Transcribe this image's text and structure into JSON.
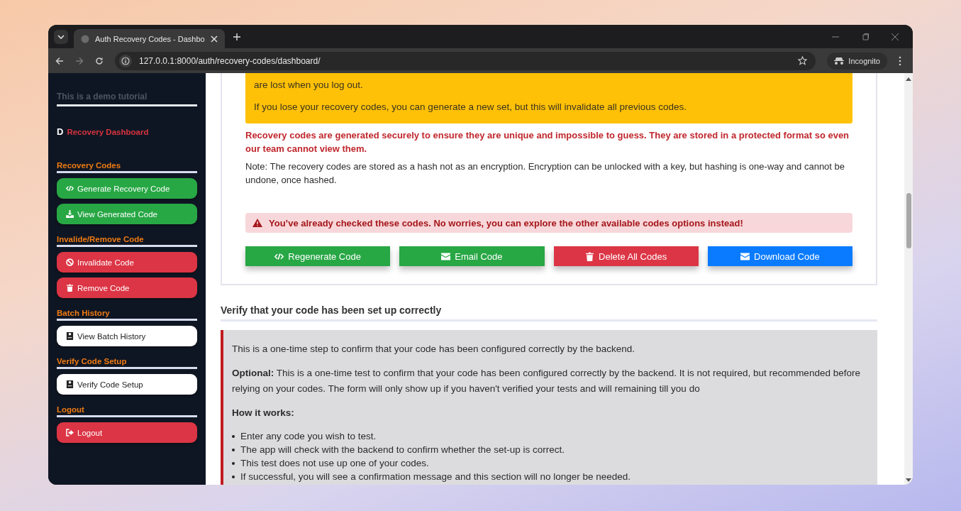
{
  "browser": {
    "tab_title": "Auth Recovery Codes - Dashbo",
    "url": "127.0.0.1:8000/auth/recovery-codes/dashboard/",
    "profile_label": "Incognito"
  },
  "sidebar": {
    "tagline": "This is a demo tutorial",
    "brand_letter": "D",
    "brand": "Recovery Dashboard",
    "sections": [
      {
        "title": "Recovery Codes",
        "buttons": [
          {
            "label": "Generate Recovery Code",
            "kind": "success"
          },
          {
            "label": "View Generated Code",
            "kind": "success"
          }
        ]
      },
      {
        "title": "Invalide/Remove Code",
        "buttons": [
          {
            "label": "Invalidate Code",
            "kind": "danger"
          },
          {
            "label": "Remove Code",
            "kind": "danger"
          }
        ]
      },
      {
        "title": "Batch History",
        "buttons": [
          {
            "label": "View Batch History",
            "kind": "light"
          }
        ]
      },
      {
        "title": "Verify Code Setup",
        "buttons": [
          {
            "label": "Verify Code Setup",
            "kind": "light"
          }
        ]
      },
      {
        "title": "Logout",
        "buttons": [
          {
            "label": "Logout",
            "kind": "danger"
          }
        ]
      }
    ]
  },
  "main": {
    "notice_lines": [
      "are lost when you log out.",
      "If you lose your recovery codes, you can generate a new set, but this will invalidate all previous codes."
    ],
    "secure_text": "Recovery codes are generated securely to ensure they are unique and impossible to guess. They are stored in a protected format so even our team cannot view them.",
    "note_text": "Note: The recovery codes are stored as a hash not as an encryption. Encryption can be unlocked with a key, but hashing is one-way and cannot be undone, once hashed.",
    "alert": "You’ve already checked these codes. No worries, you can explore the other available codes options instead!",
    "actions": [
      {
        "label": "Regenerate Code",
        "kind": "success"
      },
      {
        "label": "Email Code",
        "kind": "success"
      },
      {
        "label": "Delete All Codes",
        "kind": "danger"
      },
      {
        "label": "Download Code",
        "kind": "primary"
      }
    ],
    "verify": {
      "heading": "Verify that your code has been set up correctly",
      "intro": "This is a one-time step to confirm that your code has been configured correctly by the backend.",
      "optional": "**Optional:** This is a one-time test to confirm that your code has been configured correctly by the backend. It is not required, but recommended before relying on your codes. The form will only show up if you haven't verified your tests and will remaining till you do",
      "how_title": "How it works:",
      "steps": [
        "Enter any code you wish to test.",
        "The app will check with the backend to confirm whether the set-up is correct.",
        "This test does not use up one of your codes.",
        "If successful, you will see a confirmation message and this section will no longer be needed."
      ]
    }
  }
}
